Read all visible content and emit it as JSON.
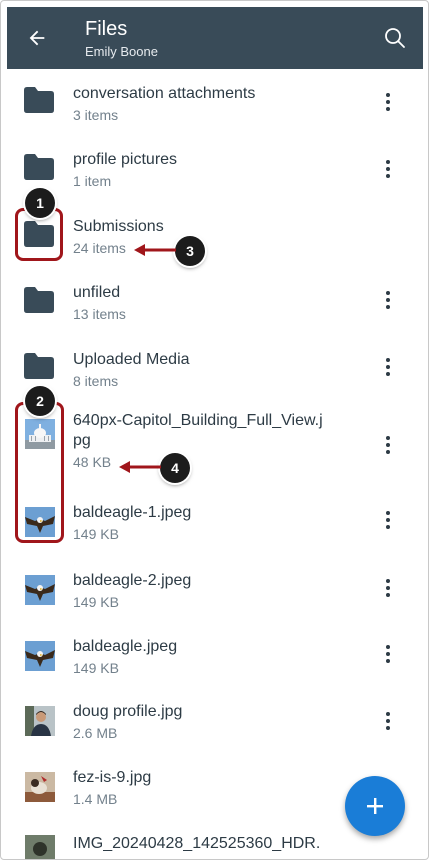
{
  "header": {
    "title": "Files",
    "subtitle": "Emily Boone",
    "back_icon": "arrow-left-icon",
    "search_icon": "search-icon",
    "background": "#394b58"
  },
  "folders": [
    {
      "name": "conversation attachments",
      "meta": "3 items",
      "has_menu": true
    },
    {
      "name": "profile pictures",
      "meta": "1 item",
      "has_menu": true
    },
    {
      "name": "Submissions",
      "meta": "24 items",
      "has_menu": false
    },
    {
      "name": "unfiled",
      "meta": "13 items",
      "has_menu": true
    },
    {
      "name": "Uploaded Media",
      "meta": "8 items",
      "has_menu": true
    }
  ],
  "files": [
    {
      "name_line1": "640px-Capitol_Building_Full_View.j",
      "name_line2": "pg",
      "meta": "48 KB",
      "thumb": "capitol-building"
    },
    {
      "name": "baldeagle-1.jpeg",
      "meta": "149 KB",
      "thumb": "eagle"
    },
    {
      "name": "baldeagle-2.jpeg",
      "meta": "149 KB",
      "thumb": "eagle"
    },
    {
      "name": "baldeagle.jpeg",
      "meta": "149 KB",
      "thumb": "eagle"
    },
    {
      "name": "doug profile.jpg",
      "meta": "2.6 MB",
      "thumb": "person"
    },
    {
      "name": "fez-is-9.jpg",
      "meta": "1.4 MB",
      "thumb": "dog"
    },
    {
      "name": "IMG_20240428_142525360_HDR.",
      "thumb": "photo"
    }
  ],
  "callouts": [
    "1",
    "2",
    "3",
    "4"
  ],
  "colors": {
    "accent": "#1a7dd7",
    "highlight": "#a0161b",
    "folder": "#394b58",
    "text": "#2d3b45",
    "meta": "#73818c"
  },
  "fab": {
    "icon": "plus-icon"
  }
}
